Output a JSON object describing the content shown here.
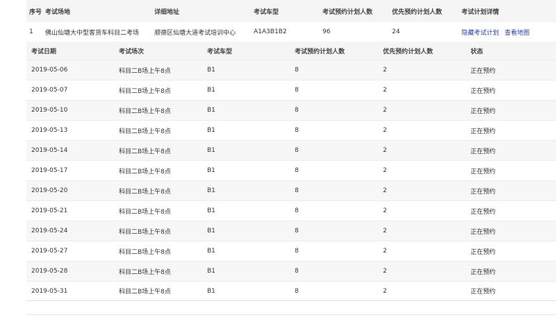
{
  "outer": {
    "headers": [
      "序号",
      "考试场地",
      "详细地址",
      "考试车型",
      "考试预约计划人数",
      "优先预约计划人数",
      "考试计划详情"
    ],
    "row": {
      "index": "1",
      "site": "佛山仙塘大中型客货车科目二考场",
      "address": "顺德区仙塘大道考试培训中心",
      "vehicle": "A1A3B1B2",
      "plan_count": "96",
      "priority_count": "24",
      "link_hide": "隐藏考试计划",
      "link_map": "查看地图"
    }
  },
  "inner": {
    "headers": [
      "考试日期",
      "考试场次",
      "考试车型",
      "考试预约计划人数",
      "优先预约计划人数",
      "状态"
    ],
    "rows": [
      [
        "2019-05-06",
        "科目二B场上午8点",
        "B1",
        "8",
        "2",
        "正在预约"
      ],
      [
        "2019-05-07",
        "科目二B场上午8点",
        "B1",
        "8",
        "2",
        "正在预约"
      ],
      [
        "2019-05-10",
        "科目二B场上午8点",
        "B1",
        "8",
        "2",
        "正在预约"
      ],
      [
        "2019-05-13",
        "科目二B场上午8点",
        "B1",
        "8",
        "2",
        "正在预约"
      ],
      [
        "2019-05-14",
        "科目二B场上午8点",
        "B1",
        "8",
        "2",
        "正在预约"
      ],
      [
        "2019-05-17",
        "科目二B场上午8点",
        "B1",
        "8",
        "2",
        "正在预约"
      ],
      [
        "2019-05-20",
        "科目二B场上午8点",
        "B1",
        "8",
        "2",
        "正在预约"
      ],
      [
        "2019-05-21",
        "科目二B场上午8点",
        "B1",
        "8",
        "2",
        "正在预约"
      ],
      [
        "2019-05-24",
        "科目二B场上午8点",
        "B1",
        "8",
        "2",
        "正在预约"
      ],
      [
        "2019-05-27",
        "科目二B场上午8点",
        "B1",
        "8",
        "2",
        "正在预约"
      ],
      [
        "2019-05-28",
        "科目二B场上午8点",
        "B1",
        "8",
        "2",
        "正在预约"
      ],
      [
        "2019-05-31",
        "科目二B场上午8点",
        "B1",
        "8",
        "2",
        "正在预约"
      ]
    ]
  }
}
